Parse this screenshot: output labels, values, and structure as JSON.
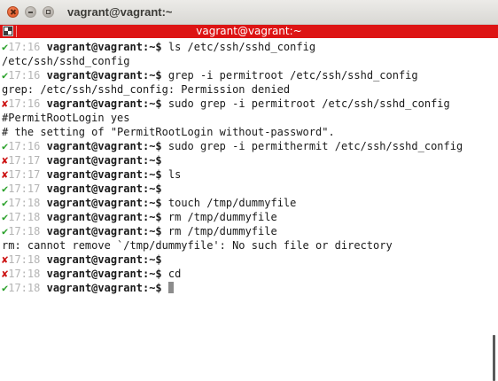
{
  "window": {
    "title": "vagrant@vagrant:~"
  },
  "tab": {
    "title": "vagrant@vagrant:~"
  },
  "icons": {
    "ok": "✔",
    "error": "✘"
  },
  "colors": {
    "tab_bar": "#dd1414",
    "ok": "#2aa12a",
    "error": "#cc1111",
    "time": "#b4b4b4"
  },
  "terminal": {
    "prompt": "vagrant@vagrant:~$",
    "lines": [
      {
        "type": "prompt",
        "status": "ok",
        "time": "17:16",
        "command": "ls /etc/ssh/sshd_config"
      },
      {
        "type": "output",
        "text": "/etc/ssh/sshd_config"
      },
      {
        "type": "prompt",
        "status": "ok",
        "time": "17:16",
        "command": "grep -i permitroot /etc/ssh/sshd_config"
      },
      {
        "type": "output",
        "text": "grep: /etc/ssh/sshd_config: Permission denied"
      },
      {
        "type": "prompt",
        "status": "error",
        "time": "17:16",
        "command": "sudo grep -i permitroot /etc/ssh/sshd_config"
      },
      {
        "type": "output",
        "text": "#PermitRootLogin yes"
      },
      {
        "type": "output",
        "text": "# the setting of \"PermitRootLogin without-password\"."
      },
      {
        "type": "prompt",
        "status": "ok",
        "time": "17:16",
        "command": "sudo grep -i permithermit /etc/ssh/sshd_config"
      },
      {
        "type": "prompt",
        "status": "error",
        "time": "17:17",
        "command": ""
      },
      {
        "type": "prompt",
        "status": "error",
        "time": "17:17",
        "command": "ls"
      },
      {
        "type": "prompt",
        "status": "ok",
        "time": "17:17",
        "command": ""
      },
      {
        "type": "prompt",
        "status": "ok",
        "time": "17:18",
        "command": "touch /tmp/dummyfile"
      },
      {
        "type": "prompt",
        "status": "ok",
        "time": "17:18",
        "command": "rm /tmp/dummyfile"
      },
      {
        "type": "prompt",
        "status": "ok",
        "time": "17:18",
        "command": "rm /tmp/dummyfile"
      },
      {
        "type": "output",
        "text": "rm: cannot remove `/tmp/dummyfile': No such file or directory"
      },
      {
        "type": "prompt",
        "status": "error",
        "time": "17:18",
        "command": ""
      },
      {
        "type": "prompt",
        "status": "error",
        "time": "17:18",
        "command": "cd"
      },
      {
        "type": "prompt",
        "status": "ok",
        "time": "17:18",
        "command": "",
        "cursor": true
      }
    ]
  }
}
